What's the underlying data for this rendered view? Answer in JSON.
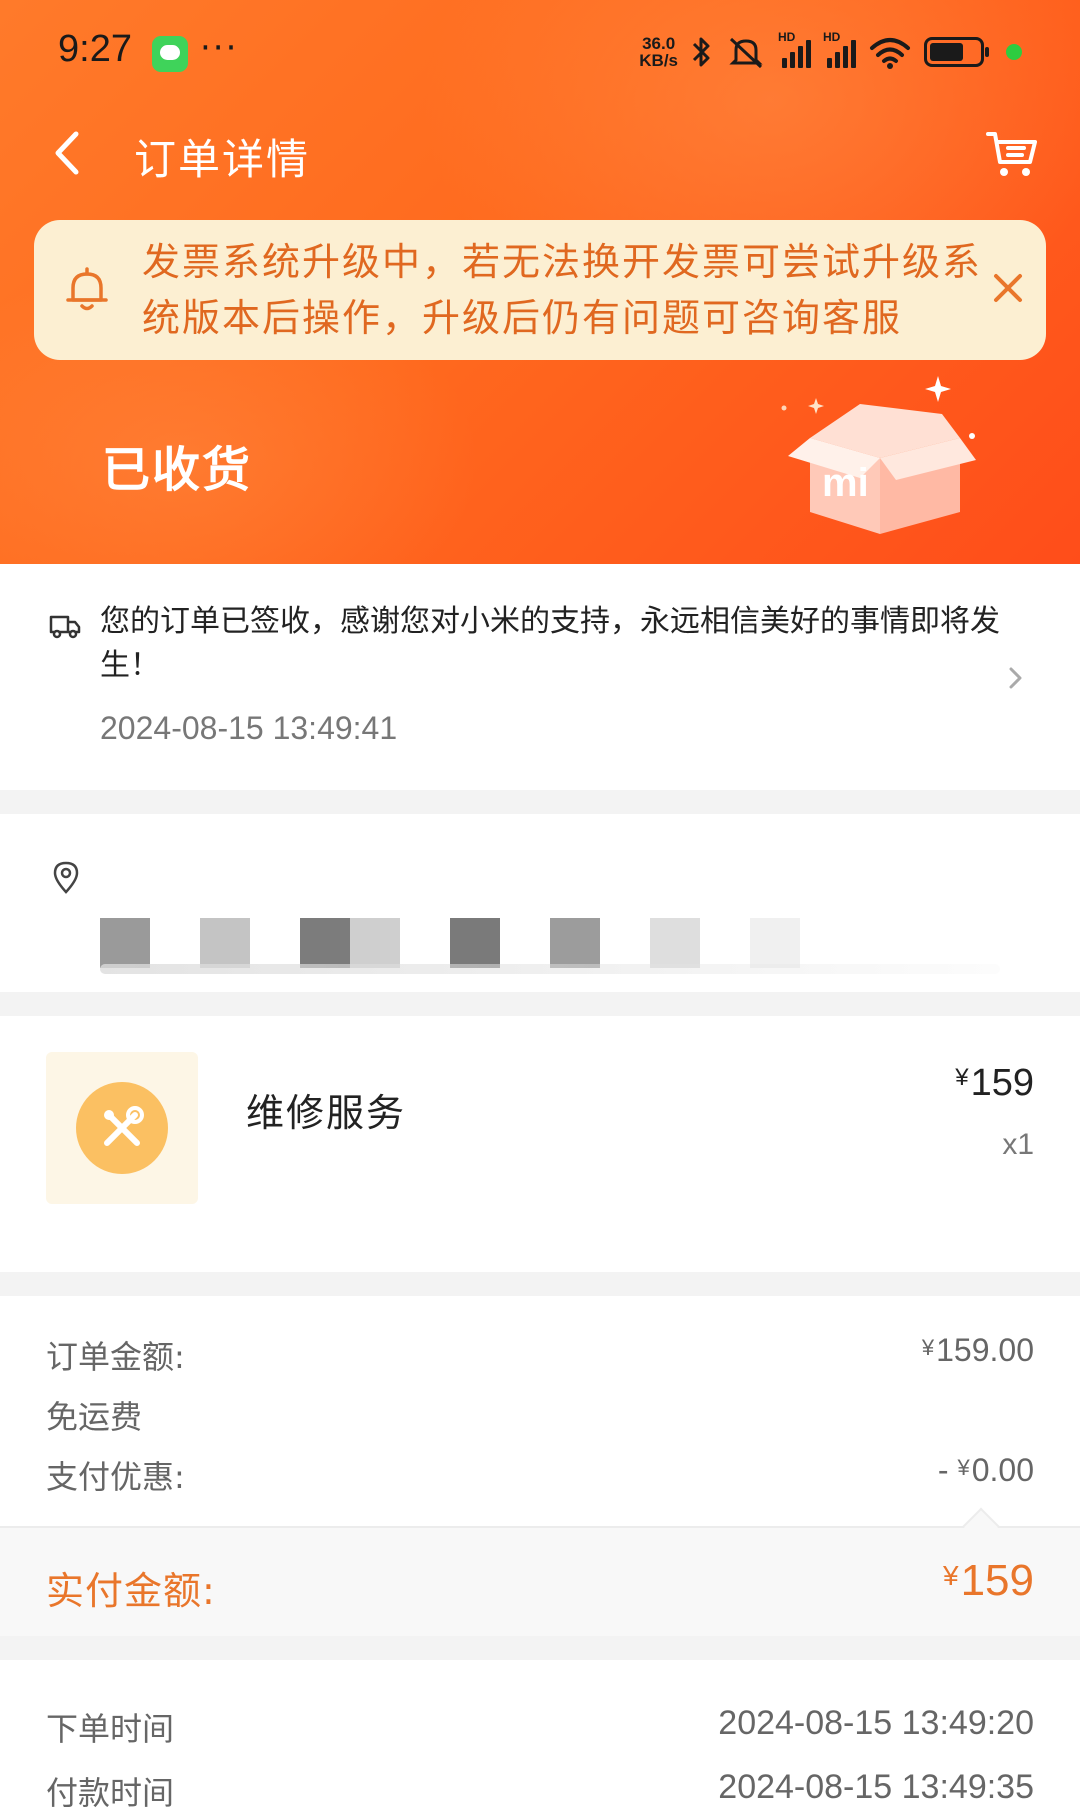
{
  "status_bar": {
    "time": "9:27",
    "network_speed": "36.0",
    "network_speed_unit": "KB/s",
    "signal_label": "HD"
  },
  "nav": {
    "title": "订单详情"
  },
  "notice": {
    "text": "发票系统升级中，若无法换开发票可尝试升级系统版本后操作，升级后仍有问题可咨询客服"
  },
  "order_status": {
    "title": "已收货"
  },
  "delivery": {
    "message": "您的订单已签收，感谢您对小米的支持，永远相信美好的事情即将发生！",
    "time": "2024-08-15 13:49:41"
  },
  "product": {
    "name": "维修服务",
    "currency": "¥",
    "price": "159",
    "quantity": "x1"
  },
  "amounts": {
    "order_amount_label": "订单金额:",
    "order_amount_currency": "¥",
    "order_amount_value": "159.00",
    "shipping_label": "免运费",
    "discount_label": "支付优惠:",
    "discount_prefix": "- ",
    "discount_currency": "¥",
    "discount_value": "0.00",
    "paid_label": "实付金额:",
    "paid_currency": "¥",
    "paid_value": "159"
  },
  "times": {
    "order_time_label": "下单时间",
    "order_time_value": "2024-08-15 13:49:20",
    "pay_time_label": "付款时间",
    "pay_time_value": "2024-08-15 13:49:35"
  },
  "colors": {
    "header_orange": "#ff6a1e",
    "accent_orange": "#e9762b",
    "notice_bg": "#fcefd2"
  }
}
